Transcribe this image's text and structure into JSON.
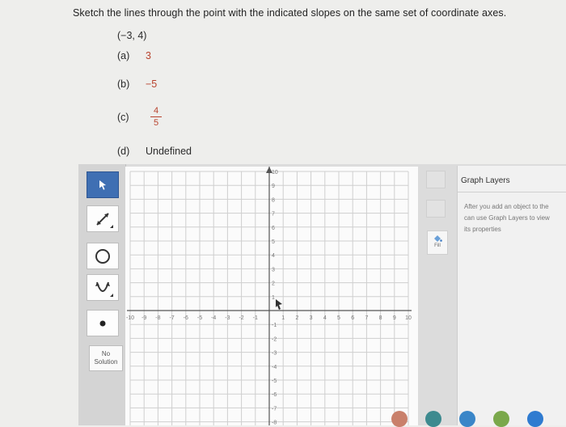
{
  "question": {
    "prompt": "Sketch the lines through the point with the indicated slopes on the same set of coordinate axes.",
    "point": "(−3, 4)",
    "parts": [
      {
        "label": "(a)",
        "value": "3"
      },
      {
        "label": "(b)",
        "value": "−5"
      },
      {
        "label": "(c)",
        "value_numerator": "4",
        "value_denominator": "5"
      },
      {
        "label": "(d)",
        "value": "Undefined"
      }
    ],
    "accent_color": "#b8432e"
  },
  "toolbar": {
    "tools": [
      {
        "name": "select",
        "icon": "arrow-cursor-icon",
        "selected": true
      },
      {
        "name": "line",
        "icon": "line-segment-icon"
      },
      {
        "name": "circle",
        "icon": "circle-icon"
      },
      {
        "name": "parabola",
        "icon": "parabola-icon"
      },
      {
        "name": "point",
        "icon": "point-icon"
      }
    ],
    "no_solution_line1": "No",
    "no_solution_line2": "Solution",
    "selected_color": "#3f6fb3"
  },
  "graph": {
    "x_range": [
      -10,
      10
    ],
    "y_range": [
      -10,
      10
    ],
    "x_tick_labels": [
      "-10",
      "-9",
      "-8",
      "-7",
      "-6",
      "-5",
      "-4",
      "-3",
      "-2",
      "-1",
      "1",
      "2",
      "3",
      "4",
      "5",
      "6",
      "7",
      "8",
      "9",
      "10"
    ],
    "y_tick_labels": [
      "10",
      "9",
      "8",
      "7",
      "6",
      "5",
      "4",
      "3",
      "2",
      "1",
      "-1",
      "-2",
      "-3",
      "-4",
      "-5",
      "-6",
      "-7",
      "-8"
    ]
  },
  "side_panel": {
    "fill_label": "Fill"
  },
  "layers": {
    "title": "Graph Layers",
    "line1": "After you add an object to the",
    "line2": "can use Graph Layers to view",
    "line3": "its properties"
  }
}
